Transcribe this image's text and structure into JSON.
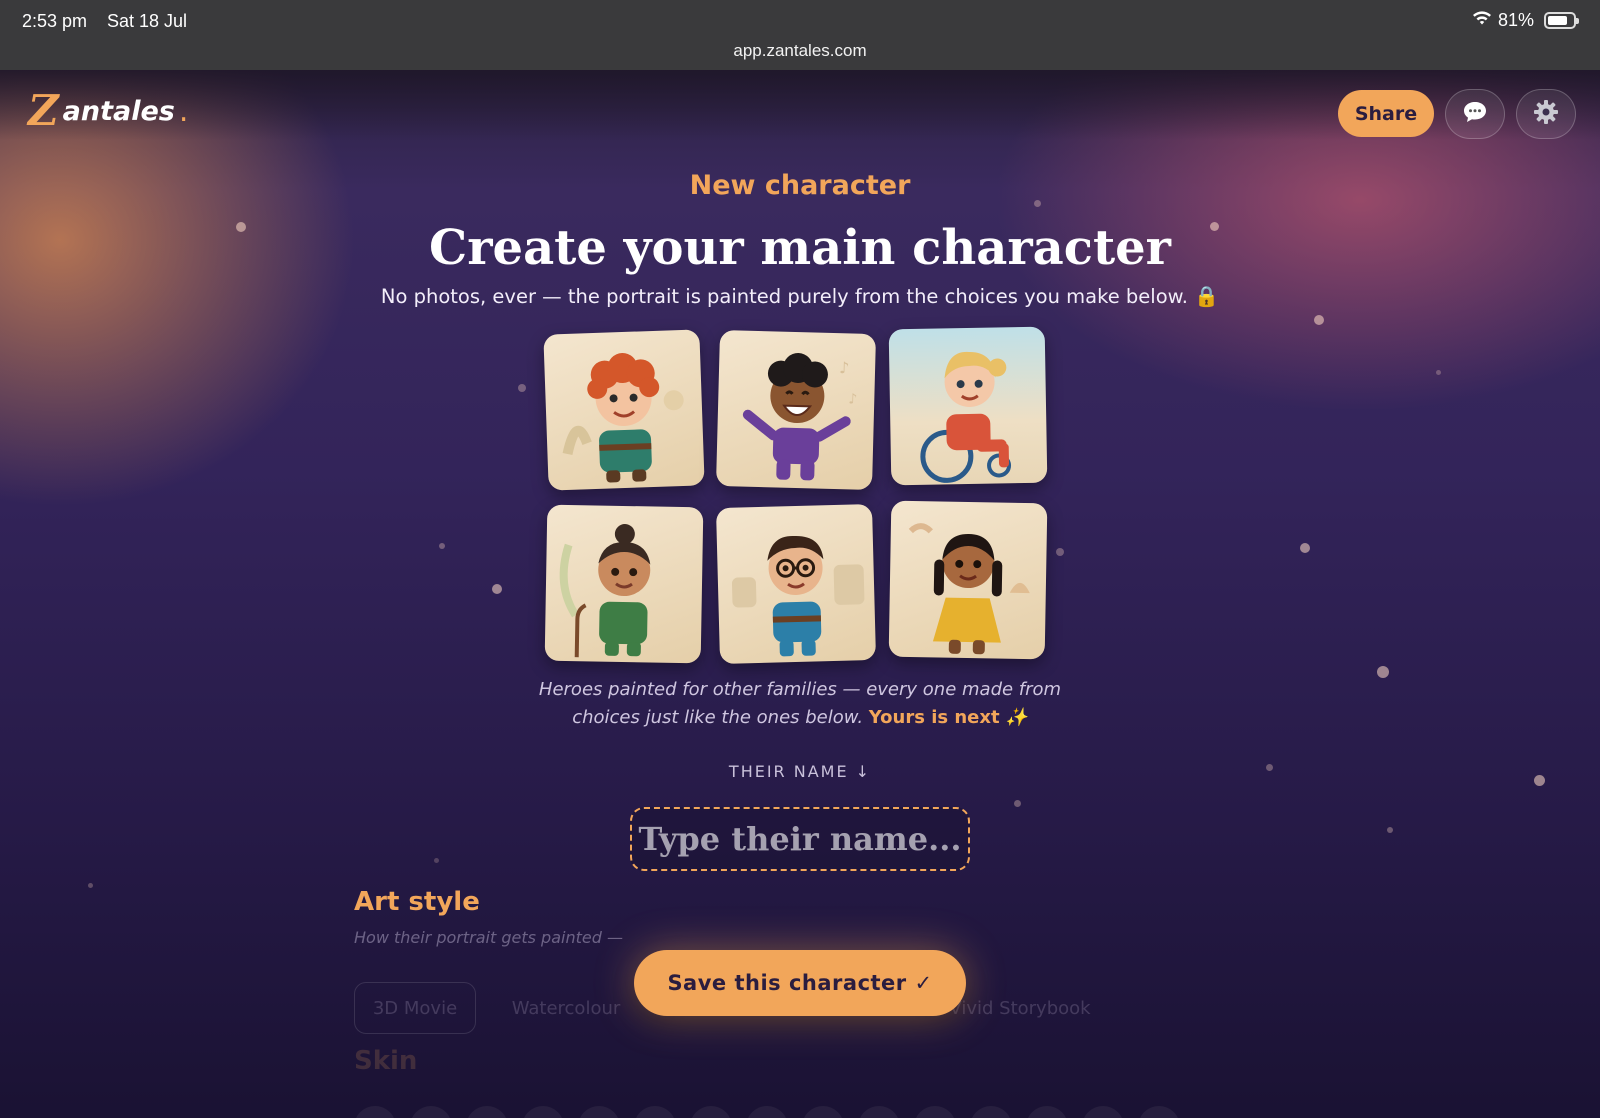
{
  "status_bar": {
    "time": "2:53 pm",
    "date": "Sat 18 Jul",
    "url": "app.zantales.com",
    "battery": "81%",
    "battery_level": 0.81
  },
  "header": {
    "logo_letter": "Z",
    "logo_text": "antales",
    "logo_dot": ".",
    "share_label": "Share",
    "chat_icon": "chat-bubble-icon",
    "settings_icon": "gear-icon"
  },
  "hero": {
    "kicker": "New character",
    "title": "Create your main character",
    "subtitle": "No photos, ever — the portrait is painted purely from the choices you make below.",
    "lock_icon": "🔒"
  },
  "gallery": {
    "caption_line1": "Heroes painted for other families — every one made from",
    "caption_line2": "choices just like the ones below.",
    "caption_highlight": "Yours is next",
    "sparkle": "✨"
  },
  "name_field": {
    "label": "THEIR NAME ↓",
    "placeholder": "Type their name...",
    "value": ""
  },
  "art_style": {
    "title": "Art style",
    "subtitle": "How their portrait gets painted —",
    "options": [
      "3D Movie",
      "Watercolour",
      "Vivid Storybook"
    ]
  },
  "skin": {
    "title": "Skin"
  },
  "save_button": {
    "label": "Save this character ✓"
  },
  "colors": {
    "accent": "#f2a65a",
    "background": "#2a1d47",
    "button_text": "#2b1d3f"
  }
}
